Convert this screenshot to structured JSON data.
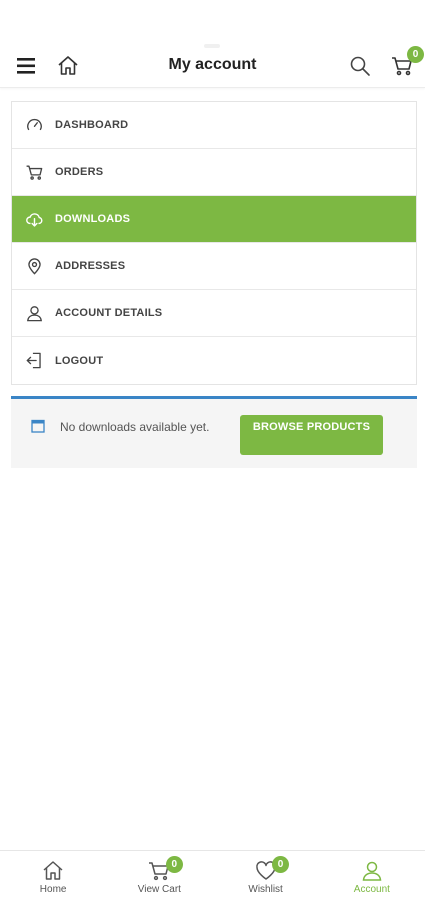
{
  "header": {
    "title": "My account",
    "cart_count": "0"
  },
  "account_menu": {
    "items": [
      {
        "label": "DASHBOARD",
        "icon": "gauge-icon",
        "active": false
      },
      {
        "label": "ORDERS",
        "icon": "cart-icon",
        "active": false
      },
      {
        "label": "DOWNLOADS",
        "icon": "cloud-download-icon",
        "active": true
      },
      {
        "label": "ADDRESSES",
        "icon": "map-pin-icon",
        "active": false
      },
      {
        "label": "ACCOUNT DETAILS",
        "icon": "user-icon",
        "active": false
      },
      {
        "label": "LOGOUT",
        "icon": "logout-icon",
        "active": false
      }
    ]
  },
  "notice": {
    "text": "No downloads available yet.",
    "button_label": "BROWSE PRODUCTS"
  },
  "bottom_nav": {
    "items": [
      {
        "label": "Home",
        "icon": "home-icon",
        "badge": null,
        "active": false
      },
      {
        "label": "View Cart",
        "icon": "cart-icon",
        "badge": "0",
        "active": false
      },
      {
        "label": "Wishlist",
        "icon": "heart-icon",
        "badge": "0",
        "active": false
      },
      {
        "label": "Account",
        "icon": "user-icon",
        "badge": null,
        "active": true
      }
    ]
  },
  "colors": {
    "accent": "#7db843",
    "info_border": "#3a85c6"
  }
}
